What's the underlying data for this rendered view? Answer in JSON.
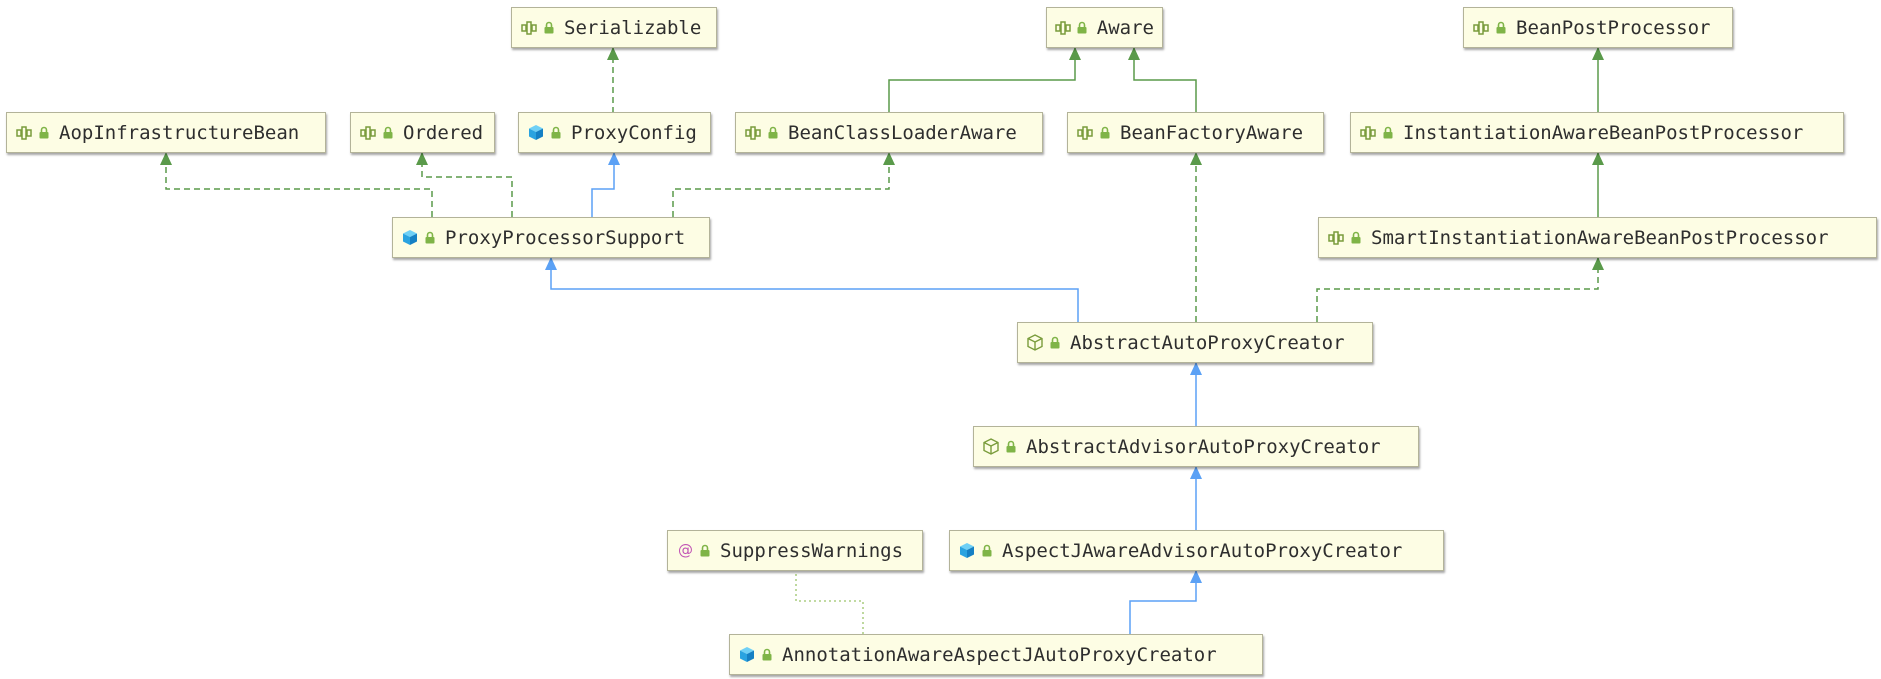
{
  "nodes": {
    "serializable": {
      "label": "Serializable",
      "kind": "interface"
    },
    "aware": {
      "label": "Aware",
      "kind": "interface"
    },
    "bean_post_processor": {
      "label": "BeanPostProcessor",
      "kind": "interface"
    },
    "aop_infrastructure_bean": {
      "label": "AopInfrastructureBean",
      "kind": "interface"
    },
    "ordered": {
      "label": "Ordered",
      "kind": "interface"
    },
    "proxy_config": {
      "label": "ProxyConfig",
      "kind": "class"
    },
    "bean_class_loader_aware": {
      "label": "BeanClassLoaderAware",
      "kind": "interface"
    },
    "bean_factory_aware": {
      "label": "BeanFactoryAware",
      "kind": "interface"
    },
    "instantiation_aware_bpp": {
      "label": "InstantiationAwareBeanPostProcessor",
      "kind": "interface"
    },
    "proxy_processor_support": {
      "label": "ProxyProcessorSupport",
      "kind": "class"
    },
    "smart_instantiation_aware_bpp": {
      "label": "SmartInstantiationAwareBeanPostProcessor",
      "kind": "interface"
    },
    "abstract_auto_proxy_creator": {
      "label": "AbstractAutoProxyCreator",
      "kind": "abstract-class"
    },
    "abstract_advisor_auto_proxy_creator": {
      "label": "AbstractAdvisorAutoProxyCreator",
      "kind": "abstract-class"
    },
    "suppress_warnings": {
      "label": "SuppressWarnings",
      "kind": "annotation"
    },
    "aspectj_aware_advisor_auto_proxy_creator": {
      "label": "AspectJAwareAdvisorAutoProxyCreator",
      "kind": "class"
    },
    "annotation_aware_aspectj_auto_proxy_creator": {
      "label": "AnnotationAwareAspectJAutoProxyCreator",
      "kind": "class"
    }
  },
  "edges": [
    {
      "from": "proxy_config",
      "to": "serializable",
      "type": "implements"
    },
    {
      "from": "bean_class_loader_aware",
      "to": "aware",
      "type": "extends-interface"
    },
    {
      "from": "bean_factory_aware",
      "to": "aware",
      "type": "extends-interface"
    },
    {
      "from": "instantiation_aware_bpp",
      "to": "bean_post_processor",
      "type": "extends-interface"
    },
    {
      "from": "smart_instantiation_aware_bpp",
      "to": "instantiation_aware_bpp",
      "type": "extends-interface"
    },
    {
      "from": "proxy_processor_support",
      "to": "aop_infrastructure_bean",
      "type": "implements"
    },
    {
      "from": "proxy_processor_support",
      "to": "ordered",
      "type": "implements"
    },
    {
      "from": "proxy_processor_support",
      "to": "proxy_config",
      "type": "extends"
    },
    {
      "from": "proxy_processor_support",
      "to": "bean_class_loader_aware",
      "type": "implements"
    },
    {
      "from": "abstract_auto_proxy_creator",
      "to": "proxy_processor_support",
      "type": "extends"
    },
    {
      "from": "abstract_auto_proxy_creator",
      "to": "bean_factory_aware",
      "type": "implements"
    },
    {
      "from": "abstract_auto_proxy_creator",
      "to": "smart_instantiation_aware_bpp",
      "type": "implements"
    },
    {
      "from": "abstract_advisor_auto_proxy_creator",
      "to": "abstract_auto_proxy_creator",
      "type": "extends"
    },
    {
      "from": "aspectj_aware_advisor_auto_proxy_creator",
      "to": "abstract_advisor_auto_proxy_creator",
      "type": "extends"
    },
    {
      "from": "annotation_aware_aspectj_auto_proxy_creator",
      "to": "aspectj_aware_advisor_auto_proxy_creator",
      "type": "extends"
    },
    {
      "from": "annotation_aware_aspectj_auto_proxy_creator",
      "to": "suppress_warnings",
      "type": "annotated-by"
    }
  ],
  "colors": {
    "implements": "#5a9a4a",
    "extends": "#5ba1f5",
    "annotated_by": "#9cc46a",
    "node_fill": "#fdfde4",
    "node_border": "#b3b399"
  }
}
